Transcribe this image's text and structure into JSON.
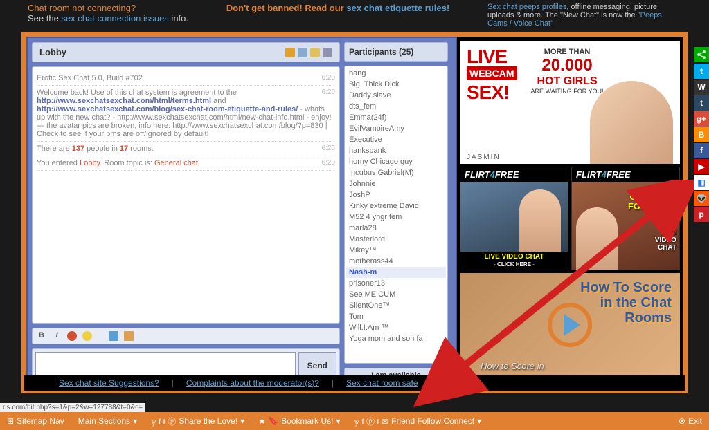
{
  "top": {
    "left_line1": "Chat room not connecting?",
    "left_line2_prefix": "See the ",
    "left_link": "sex chat connection issues",
    "left_suffix": " info.",
    "center_prefix": "Don't get banned! Read our ",
    "center_link": "sex chat etiquette rules!",
    "right_link1": "Sex chat peeps profiles",
    "right_mid": ", offline messaging, picture uploads & more. The \"New Chat\" is now the ",
    "right_link2": "\"Peeps Cams / Voice Chat\""
  },
  "chat": {
    "room_title": "Lobby",
    "participants_label": "Participants (25)",
    "status_label": "I am available",
    "send_label": "Send",
    "messages": [
      {
        "time": "6:20",
        "text": "Erotic Sex Chat 5.0, Build #702"
      },
      {
        "time": "6:20",
        "html": "Welcome back! Use of this chat system is agreement to the <a>http://www.sexchatsexchat.com/html/terms.html</a> and <a>http://www.sexchatsexchat.com/blog/sex-chat-room-etiquette-and-rules/</a> - whats up with the new chat? - http://www.sexchatsexchat.com/html/new-chat-info.html - enjoy! --- the avatar pics are broken, info here: http://www.sexchatsexchat.com/blog/?p=830 | Check to see if your pms are off/ignored by default!"
      },
      {
        "time": "6:20",
        "html": "There are <span class='highlight-num'>137</span> people in <span class='highlight-num'>17</span> rooms."
      },
      {
        "time": "6:20",
        "html": "You entered <span class='highlight-room'>Lobby</span>. Room topic is: <span class='highlight-room'>General chat.</span>"
      }
    ],
    "participants": [
      "bang",
      "Big, Thick Dick",
      "Daddy slave",
      "dts_fem",
      "Emma(24f)",
      "EvilVampireAmy",
      "Executive",
      "hankspank",
      "horny Chicago guy",
      "Incubus Gabriel(M)",
      "Johnnie",
      "JoshP",
      "Kinky extreme David",
      "M52 4 yngr fem",
      "marla28",
      "Masterlord",
      "Mikey™",
      "motherass44",
      "Nash-m",
      "prisoner13",
      "See ME CUM",
      "SilentOne™",
      "Tom",
      "Will.I.Am ™",
      "Yoga mom and son fa"
    ],
    "self": "Nash-m"
  },
  "toolbar": {
    "bold": "B",
    "italic": "I"
  },
  "ads": {
    "live": "LIVE",
    "webcam": "WEBCAM",
    "sex": "SEX!",
    "more_than": "MORE THAN",
    "count": "20.000",
    "hot_girls": "HOT GIRLS",
    "waiting": "ARE WAITING FOR YOU!",
    "jasmin": "JASMIN",
    "f4f_brand_a": "FLIRT",
    "f4f_brand_b": "4",
    "f4f_brand_c": "FREE",
    "f4f_bottom1": "LIVE VIDEO CHAT",
    "f4f_click": "- CLICK HERE -",
    "f4f_text2a": "CHAT LIVE",
    "f4f_text2b": "FOR FREE!",
    "f4f_text2c": "LIVE",
    "f4f_text2d": "VIDEO",
    "f4f_text2e": "CHAT",
    "score_line1": "How To Score",
    "score_line2": "in the Chat",
    "score_line3": "Rooms",
    "score_label": "How to Score in"
  },
  "bottom_links": [
    "Sex chat site Suggestions?",
    "Complaints about the moderator(s)?",
    "Sex chat room safe"
  ],
  "footer": {
    "sitemap": "Sitemap Nav",
    "main": "Main Sections",
    "share": "Share the Love!",
    "bookmark": "Bookmark Us!",
    "follow": "Friend Follow Connect",
    "exit": "Exit",
    "url_hint": "rls.com/hit.php?s=1&p=2&w=127788&t=0&c="
  },
  "social": [
    {
      "bg": "#00acee",
      "label": "t"
    },
    {
      "bg": "#333",
      "label": "W"
    },
    {
      "bg": "#2c4762",
      "label": "t"
    },
    {
      "bg": "#dd4b39",
      "label": "g+"
    },
    {
      "bg": "#ff8c00",
      "label": "B"
    },
    {
      "bg": "#3b5998",
      "label": "f"
    },
    {
      "bg": "#cc0000",
      "label": "▶"
    },
    {
      "bg": "#fff",
      "label": "◧",
      "fg": "#3274d1"
    },
    {
      "bg": "#ff5700",
      "label": "👽"
    },
    {
      "bg": "#cb2027",
      "label": "p"
    }
  ]
}
